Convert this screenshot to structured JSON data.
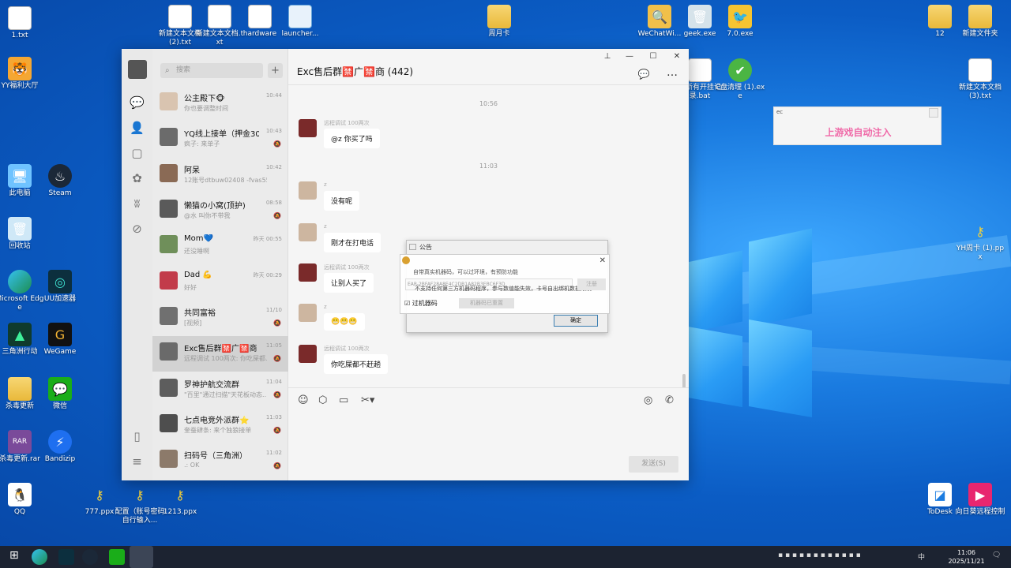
{
  "desktop": {
    "icons_left": [
      {
        "name": "1.txt",
        "kind": "file"
      },
      {
        "name": "YY福利大厅",
        "kind": "app"
      },
      {
        "name": "此电脑",
        "kind": "app"
      },
      {
        "name": "Steam",
        "kind": "app"
      },
      {
        "name": "回收站",
        "kind": "app"
      },
      {
        "name": "Microsoft Edge",
        "kind": "app"
      },
      {
        "name": "UU加速器",
        "kind": "app"
      },
      {
        "name": "三角洲行动",
        "kind": "app"
      },
      {
        "name": "WeGame",
        "kind": "app"
      },
      {
        "name": "杀毒更新",
        "kind": "folder"
      },
      {
        "name": "微信",
        "kind": "app"
      },
      {
        "name": "杀毒更新.rar",
        "kind": "app"
      },
      {
        "name": "Bandizip",
        "kind": "app"
      },
      {
        "name": "QQ",
        "kind": "app"
      }
    ],
    "icons_top": [
      {
        "name": "新建文本文档 (2).txt"
      },
      {
        "name": "新建文本文档.txt"
      },
      {
        "name": "hardware"
      },
      {
        "name": "launcher..."
      },
      {
        "name": "周月卡"
      },
      {
        "name": "WeChatWi..."
      },
      {
        "name": "geek.exe"
      },
      {
        "name": "7.0.exe"
      },
      {
        "name": "12"
      },
      {
        "name": "新建文件夹"
      }
    ],
    "icons_right": [
      {
        "name": "理所有开挂记录.bat"
      },
      {
        "name": "C盘清理 (1).exe"
      },
      {
        "name": "新建文本文档 (3).txt"
      },
      {
        "name": "YH周卡 (1).ppx"
      },
      {
        "name": "ToDesk"
      },
      {
        "name": "向日葵远程控制"
      }
    ],
    "icons_bottom": [
      {
        "name": "777.ppx"
      },
      {
        "name": "配置（账号密码自行输入..."
      },
      {
        "name": "1213.ppx"
      }
    ]
  },
  "wechat": {
    "search_placeholder": "搜索",
    "chat_title": "Exc售后群🈲广🈲商 (442)",
    "chats": [
      {
        "name": "公主殿下🐵",
        "time": "10:44",
        "preview": "你也要调整时间",
        "muted": false
      },
      {
        "name": "YQ线上接单（押金300...",
        "time": "10:43",
        "preview": "疯子: 来单子",
        "muted": true
      },
      {
        "name": "阿呆",
        "time": "10:42",
        "preview": "12账号dtbuw02408 -fvas5564...",
        "muted": false
      },
      {
        "name": "懒猫の小窝(顶护)",
        "time": "08:58",
        "preview": "@水 叫你不带我",
        "muted": true
      },
      {
        "name": "Mom💙",
        "time": "昨天 00:55",
        "preview": "还没睡啊",
        "muted": false
      },
      {
        "name": "Dad 💪",
        "time": "昨天 00:29",
        "preview": "好好",
        "muted": false
      },
      {
        "name": "共同富裕",
        "time": "11/10",
        "preview": "[视频]",
        "muted": true
      },
      {
        "name": "Exc售后群🈲广🈲商",
        "time": "11:05",
        "preview": "远程调试 100两次: 你吃屎都...",
        "muted": true
      },
      {
        "name": "罗神护航交流群",
        "time": "11:04",
        "preview": "\"百里\"通过扫描\"天花板动态...",
        "muted": true
      },
      {
        "name": "七点电竞外派群⭐",
        "time": "11:03",
        "preview": "奎蚕肆条: 来个独狼接单",
        "muted": true
      },
      {
        "name": "扫码号（三角洲）",
        "time": "11:02",
        "preview": ".: OK",
        "muted": true
      }
    ],
    "timestamps": [
      "10:56",
      "11:03"
    ],
    "messages": [
      {
        "sender": "远程调试 100两次",
        "text": "@z 你买了吗"
      },
      {
        "sender": "z",
        "text": "没有呢"
      },
      {
        "sender": "z",
        "text": "刚才在打电话"
      },
      {
        "sender": "远程调试 100两次",
        "text": "让别人买了"
      },
      {
        "sender": "z",
        "text": "😬😬😬"
      },
      {
        "sender": "远程调试 100两次",
        "text": "你吃屎都不赶趟"
      }
    ],
    "send_label": "发送(S)"
  },
  "notice": {
    "title": "公告",
    "ok_label": "确定",
    "line1": "自带真实机器码，可以过环境，有预防功能",
    "input_text": "EAR-2BFAF28A8E4C2DB1A82B3EBC6F3D",
    "register_label": "注册",
    "warning": "不支持任何第三方机器码程序，参与数值能失效，卡号自出绑机数据限制",
    "checkbox_label": "过机器码",
    "machine_btn": "机器码已重置"
  },
  "side_window": {
    "title": "ec",
    "text": "上游戏自动注入"
  },
  "taskbar": {
    "time": "11:06",
    "date": "2025/11/21",
    "ime": "中"
  }
}
